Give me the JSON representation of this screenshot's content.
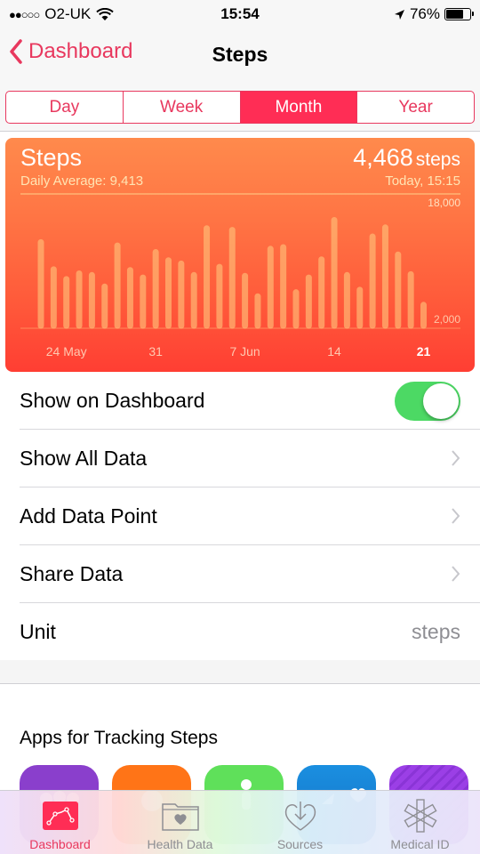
{
  "status_bar": {
    "signal_icon": "signal-dots-icon",
    "signal_dots": "●●○○○",
    "carrier": "O2-UK",
    "wifi_icon": "wifi-icon",
    "time": "15:54",
    "location_icon": "location-arrow-icon",
    "battery_percent": "76%",
    "battery_level": 0.76
  },
  "nav": {
    "back_label": "Dashboard",
    "title": "Steps"
  },
  "segments": [
    {
      "label": "Day",
      "active": false
    },
    {
      "label": "Week",
      "active": false
    },
    {
      "label": "Month",
      "active": true
    },
    {
      "label": "Year",
      "active": false
    }
  ],
  "summary": {
    "title": "Steps",
    "daily_average": "Daily Average: 9,413",
    "value": "4,468",
    "unit": "steps",
    "date": "Today, 15:15"
  },
  "chart_data": {
    "type": "bar",
    "title": "Steps",
    "xlabel": "",
    "ylabel": "steps",
    "ylim": [
      0,
      18000
    ],
    "y_tick_labels": [
      "18,000",
      "2,000"
    ],
    "x_tick_labels": [
      {
        "label": "24 May",
        "index": 2,
        "bold": false
      },
      {
        "label": "31",
        "index": 9,
        "bold": false
      },
      {
        "label": "7 Jun",
        "index": 16,
        "bold": false
      },
      {
        "label": "14",
        "index": 23,
        "bold": false
      },
      {
        "label": "21",
        "index": 30,
        "bold": true
      }
    ],
    "categories": [
      "22 May",
      "23 May",
      "24 May",
      "25 May",
      "26 May",
      "27 May",
      "28 May",
      "29 May",
      "30 May",
      "31 May",
      "1 Jun",
      "2 Jun",
      "3 Jun",
      "4 Jun",
      "5 Jun",
      "6 Jun",
      "7 Jun",
      "8 Jun",
      "9 Jun",
      "10 Jun",
      "11 Jun",
      "12 Jun",
      "13 Jun",
      "14 Jun",
      "15 Jun",
      "16 Jun",
      "17 Jun",
      "18 Jun",
      "19 Jun",
      "20 Jun",
      "21 Jun"
    ],
    "values": [
      12100,
      8800,
      7600,
      8300,
      8100,
      6700,
      11700,
      8700,
      7800,
      10900,
      9900,
      9500,
      8100,
      13800,
      9100,
      13600,
      8000,
      5500,
      11300,
      11500,
      6000,
      7800,
      10000,
      14800,
      8100,
      6300,
      12800,
      13900,
      10600,
      8200,
      4468
    ],
    "grid": true
  },
  "rows": [
    {
      "label": "Show on Dashboard",
      "type": "toggle",
      "on": true
    },
    {
      "label": "Show All Data",
      "type": "disclosure"
    },
    {
      "label": "Add Data Point",
      "type": "disclosure"
    },
    {
      "label": "Share Data",
      "type": "disclosure"
    },
    {
      "label": "Unit",
      "type": "value",
      "value": "steps"
    }
  ],
  "apps_section": {
    "title": "Apps for Tracking Steps",
    "apps": [
      {
        "name": "app-icon-1",
        "color": "#8a3fcc"
      },
      {
        "name": "app-icon-2",
        "color": "#ff7417"
      },
      {
        "name": "app-icon-3",
        "color": "#5fe05a"
      },
      {
        "name": "app-icon-4",
        "color": "#1a8fe0"
      },
      {
        "name": "app-icon-5",
        "color": "#9b3fe6"
      }
    ]
  },
  "tabs": [
    {
      "label": "Dashboard",
      "icon": "dashboard-chart-icon",
      "active": true
    },
    {
      "label": "Health Data",
      "icon": "health-data-folder-icon",
      "active": false
    },
    {
      "label": "Sources",
      "icon": "sources-heart-download-icon",
      "active": false
    },
    {
      "label": "Medical ID",
      "icon": "medical-id-asterisk-icon",
      "active": false
    }
  ],
  "colors": {
    "accent": "#ff2d55",
    "accent_text": "#e8385e",
    "toggle_on": "#4cd964",
    "chart_top": "#ff8a4c",
    "chart_bottom": "#ff3e33"
  }
}
